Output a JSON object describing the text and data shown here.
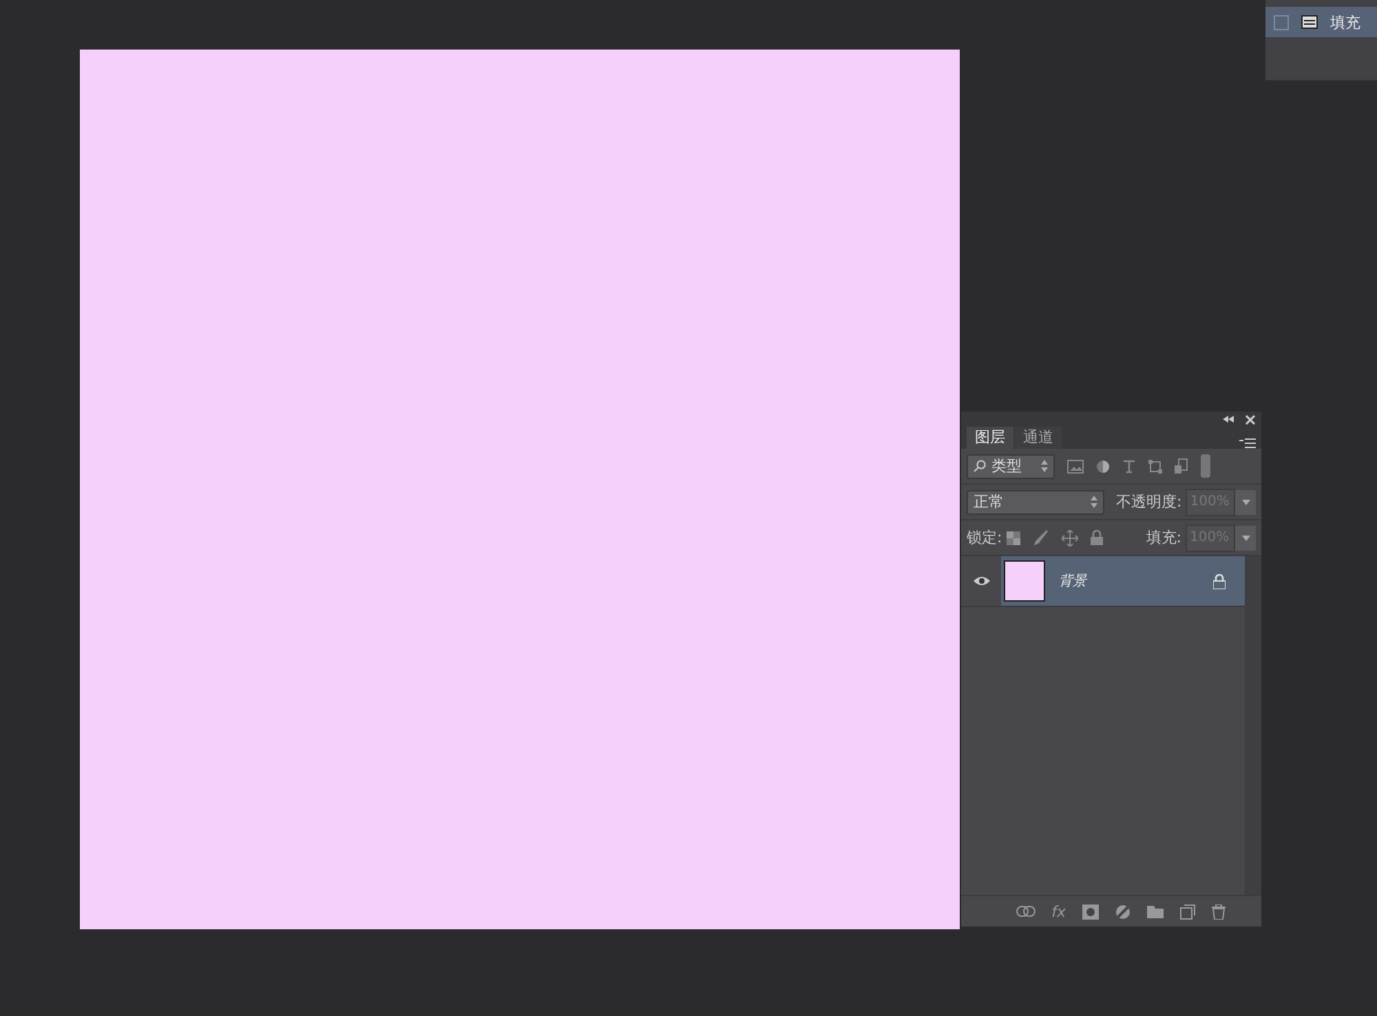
{
  "top_panel": {
    "row": {
      "label": "填充",
      "checked": false
    }
  },
  "layers_panel": {
    "tabs": [
      {
        "label": "图层",
        "selected": true
      },
      {
        "label": "通道",
        "selected": false
      }
    ],
    "filter": {
      "value": "类型"
    },
    "blend_mode": {
      "value": "正常"
    },
    "opacity": {
      "label": "不透明度:",
      "value": "100%",
      "disabled": true
    },
    "lock": {
      "label": "锁定:"
    },
    "fill": {
      "label": "填充:",
      "value": "100%",
      "disabled": true
    },
    "layers": [
      {
        "name": "背景",
        "visible": true,
        "selected": true,
        "locked": true
      }
    ],
    "footer": {
      "fx": "fx"
    }
  }
}
